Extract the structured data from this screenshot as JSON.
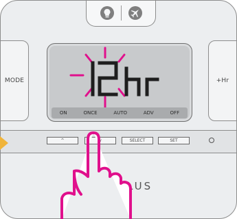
{
  "device": {
    "top_tab": {
      "left_icon": "bulb-icon",
      "right_icon": "plane-icon"
    },
    "left_button_label": "MODE",
    "right_button_label": "+Hr",
    "display": {
      "main_text": "12hr",
      "modes": [
        "ON",
        "ONCE",
        "AUTO",
        "ADV",
        "OFF"
      ]
    },
    "controls": {
      "up_label": "^",
      "down_label": "v",
      "select_label": "SELECT",
      "set_label": "SET"
    },
    "brand": "LUS"
  },
  "colors": {
    "highlight": "#e0108c",
    "arrow": "#f0b43a",
    "lcd": "#c8cacc"
  },
  "overlay": {
    "icon": "pointing-hand-icon"
  }
}
